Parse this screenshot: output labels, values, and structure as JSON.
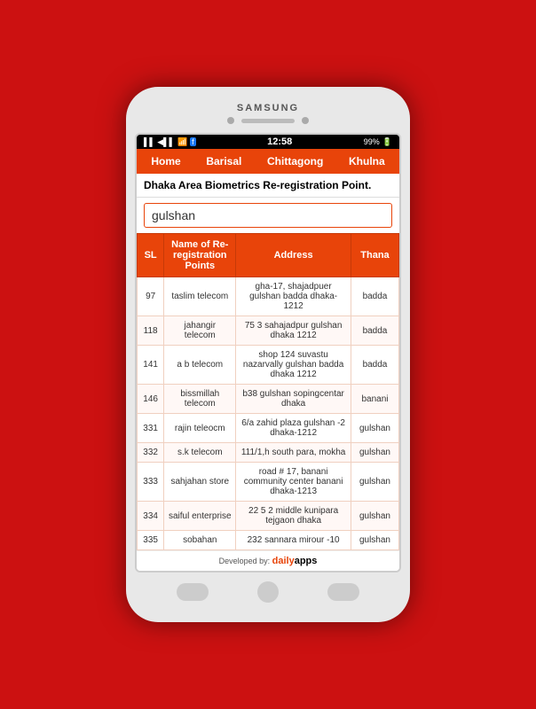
{
  "phone": {
    "brand": "SAMSUNG",
    "status_bar": {
      "signal": "▌▌ ▌▌",
      "time": "12:58",
      "battery": "99%"
    }
  },
  "nav": {
    "items": [
      "Home",
      "Barisal",
      "Chittagong",
      "Khulna"
    ]
  },
  "page": {
    "title": "Dhaka Area Biometrics Re-registration Point.",
    "search_placeholder": "gulshan",
    "search_value": "gulshan"
  },
  "table": {
    "headers": [
      "SL",
      "Name of Re-registration Points",
      "Address",
      "Thana"
    ],
    "rows": [
      {
        "sl": "97",
        "name": "taslim telecom",
        "address": "gha-17, shajadpuer gulshan badda dhaka-1212",
        "thana": "badda"
      },
      {
        "sl": "118",
        "name": "jahangir telecom",
        "address": "75 3 sahajadpur gulshan dhaka 1212",
        "thana": "badda"
      },
      {
        "sl": "141",
        "name": "a b telecom",
        "address": "shop 124 suvastu nazarvally gulshan badda dhaka 1212",
        "thana": "badda"
      },
      {
        "sl": "146",
        "name": "bissmillah telecom",
        "address": "b38 gulshan sopingcentar dhaka",
        "thana": "banani"
      },
      {
        "sl": "331",
        "name": "rajin teleocm",
        "address": "6/a zahid plaza gulshan -2 dhaka-1212",
        "thana": "gulshan"
      },
      {
        "sl": "332",
        "name": "s.k telecom",
        "address": "111/1,h south para, mokha",
        "thana": "gulshan"
      },
      {
        "sl": "333",
        "name": "sahjahan store",
        "address": "road # 17, banani community center banani dhaka-1213",
        "thana": "gulshan"
      },
      {
        "sl": "334",
        "name": "saiful enterprise",
        "address": "22 5 2 middle kunipara tejgaon dhaka",
        "thana": "gulshan"
      },
      {
        "sl": "335",
        "name": "sobahan",
        "address": "232 sannara mirour -10",
        "thana": "gulshan"
      }
    ]
  },
  "footer": {
    "developed_by": "Developed by:",
    "brand": "daily apps"
  }
}
